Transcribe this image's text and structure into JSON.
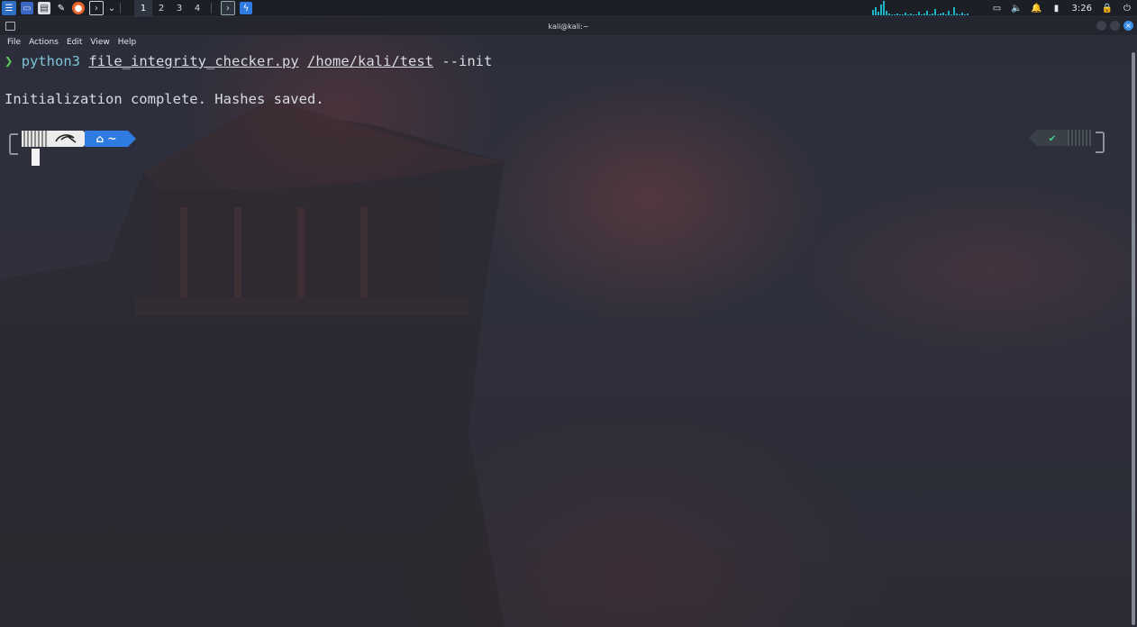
{
  "panel": {
    "workspaces": [
      "1",
      "2",
      "3",
      "4"
    ],
    "active_workspace": "1",
    "clock": "3:26"
  },
  "window": {
    "title": "kali@kali:~"
  },
  "menubar": {
    "items": [
      "File",
      "Actions",
      "Edit",
      "View",
      "Help"
    ]
  },
  "terminal": {
    "prompt_symbol": "❯",
    "command": "python3",
    "script": "file_integrity_checker.py",
    "path_arg": "/home/kali/test",
    "flag": "--init",
    "output": "Initialization complete. Hashes saved.",
    "prompt_dir": "~",
    "status_ok": "✔"
  },
  "colors": {
    "accent": "#2f7be1",
    "prompt_arrow": "#58c95c",
    "ok": "#3fd38a"
  }
}
